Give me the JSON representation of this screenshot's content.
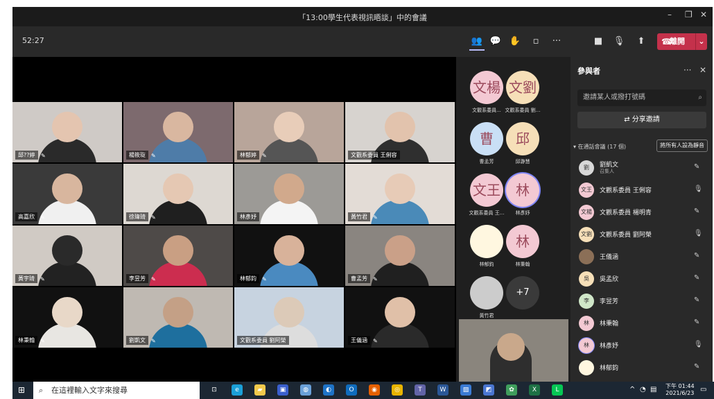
{
  "window": {
    "title": "「13:00學生代表視訊晤談」中的會議",
    "minimize": "–",
    "maximize": "❐",
    "close": "✕"
  },
  "toolbar": {
    "timer": "52:27",
    "leave_label": "離開",
    "icons": [
      "people-icon",
      "chat-icon",
      "reactions-icon",
      "rooms-icon",
      "more-icon",
      "camera-icon",
      "mic-off-icon",
      "share-icon"
    ]
  },
  "video_tiles": [
    {
      "name": "邱??婷",
      "mic": "✎"
    },
    {
      "name": "楊筱琁",
      "mic": "✎"
    },
    {
      "name": "林郁婷",
      "mic": "✎"
    },
    {
      "name": "文觀系委員 王俐容",
      "mic": ""
    },
    {
      "name": "高嘉欣",
      "mic": "✎"
    },
    {
      "name": "徐瑋琦",
      "mic": "✎"
    },
    {
      "name": "林彥妤",
      "mic": ""
    },
    {
      "name": "黃竹君",
      "mic": "✎"
    },
    {
      "name": "黃宇琦",
      "mic": "✎"
    },
    {
      "name": "李昱芳",
      "mic": "✎"
    },
    {
      "name": "林郁鈞",
      "mic": "✎"
    },
    {
      "name": "曹孟芳",
      "mic": "✎"
    },
    {
      "name": "林秉翰",
      "mic": "✎"
    },
    {
      "name": "劉凱文",
      "mic": "✎"
    },
    {
      "name": "文觀系委員 劉阿榮",
      "mic": ""
    },
    {
      "name": "王儀涵",
      "mic": "✎"
    }
  ],
  "strip_avatars": [
    {
      "initials": "文楊",
      "label": "文觀系委員...",
      "color": "#f3c9d3"
    },
    {
      "initials": "文劉",
      "label": "文觀系委員 劉...",
      "color": "#f6dfb8"
    },
    {
      "initials": "曹",
      "label": "曹孟芳",
      "color": "#c9dff5"
    },
    {
      "initials": "邱",
      "label": "邱瀞慧",
      "color": "#f6dfb8"
    },
    {
      "initials": "文王",
      "label": "文觀系委員 王...",
      "color": "#f3c9d3"
    },
    {
      "initials": "林",
      "label": "林彥妤",
      "color": "#f3c9d3"
    },
    {
      "initials": "",
      "label": "林郁鈞",
      "color": "#fff7e0"
    },
    {
      "initials": "林",
      "label": "林秉翰",
      "color": "#f3c9d3"
    },
    {
      "initials": "",
      "label": "黃竹君",
      "color": "#ccc"
    },
    {
      "initials": "+7",
      "label": "",
      "color": "#3a3a3a"
    }
  ],
  "participants_panel": {
    "title": "參與者",
    "search_placeholder": "邀請某人或撥打號碼",
    "share_invite": "分享邀請",
    "section": "在通話會議 (17 個)",
    "mute_all": "將所有人設為靜音",
    "list": [
      {
        "initials": "劉",
        "name": "劉凱文",
        "role": "召集人",
        "mic": "✎",
        "color": "#d8d8d8"
      },
      {
        "initials": "文王",
        "name": "文觀系委員 王俐容",
        "role": "",
        "mic": "🎙",
        "color": "#f3c9d3"
      },
      {
        "initials": "文楊",
        "name": "文觀系委員 楊明青",
        "role": "",
        "mic": "✎",
        "color": "#f3c9d3"
      },
      {
        "initials": "文劉",
        "name": "文觀系委員 劉阿榮",
        "role": "",
        "mic": "🎙",
        "color": "#f6dfb8"
      },
      {
        "initials": "",
        "name": "王儀涵",
        "role": "",
        "mic": "✎",
        "color": "#8b6f57"
      },
      {
        "initials": "吳",
        "name": "吳孟欣",
        "role": "",
        "mic": "✎",
        "color": "#f6dfb8"
      },
      {
        "initials": "李",
        "name": "李昱芳",
        "role": "",
        "mic": "✎",
        "color": "#cfe6c8"
      },
      {
        "initials": "林",
        "name": "林秉翰",
        "role": "",
        "mic": "✎",
        "color": "#f3c9d3"
      },
      {
        "initials": "林",
        "name": "林彥妤",
        "role": "",
        "mic": "🎙",
        "color": "#f3c9d3"
      },
      {
        "initials": "",
        "name": "林郁鈞",
        "role": "",
        "mic": "✎",
        "color": "#fff7e0"
      }
    ]
  },
  "taskbar": {
    "search_placeholder": "在這裡輸入文字來搜尋",
    "time": "下午 01:44",
    "date": "2021/6/23",
    "apps": [
      {
        "name": "task-view-icon",
        "color": "#1c2733",
        "glyph": "⊡"
      },
      {
        "name": "edge-icon",
        "color": "#1ba0d8",
        "glyph": "e"
      },
      {
        "name": "file-explorer-icon",
        "color": "#f2c94c",
        "glyph": "▰"
      },
      {
        "name": "store-icon",
        "color": "#3a5fcd",
        "glyph": "▣"
      },
      {
        "name": "app-icon",
        "color": "#6aa0d8",
        "glyph": "◍"
      },
      {
        "name": "app-icon-2",
        "color": "#1e73c7",
        "glyph": "◐"
      },
      {
        "name": "outlook-icon",
        "color": "#0f6cbd",
        "glyph": "O"
      },
      {
        "name": "firefox-icon",
        "color": "#e66000",
        "glyph": "◉"
      },
      {
        "name": "chrome-icon",
        "color": "#e8b400",
        "glyph": "◎"
      },
      {
        "name": "teams-icon",
        "color": "#6264a7",
        "glyph": "T"
      },
      {
        "name": "word-icon",
        "color": "#2b5797",
        "glyph": "W"
      },
      {
        "name": "photos-icon",
        "color": "#3b7bd4",
        "glyph": "▨"
      },
      {
        "name": "app-icon-3",
        "color": "#4a76d1",
        "glyph": "◩"
      },
      {
        "name": "app-icon-4",
        "color": "#3f9e5d",
        "glyph": "✿"
      },
      {
        "name": "excel-icon",
        "color": "#1e7145",
        "glyph": "X"
      },
      {
        "name": "line-icon",
        "color": "#06c755",
        "glyph": "L"
      }
    ]
  }
}
